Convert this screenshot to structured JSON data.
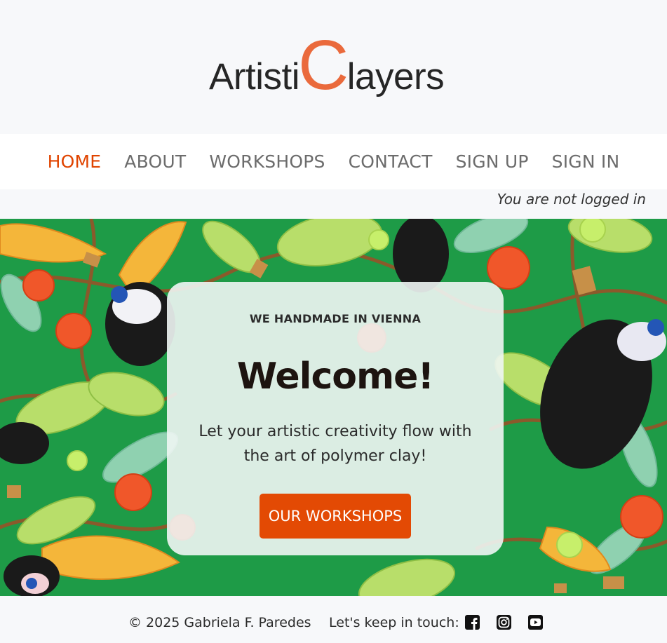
{
  "brand": {
    "logo_start": "Artisti",
    "logo_c": "C",
    "logo_end": "layers",
    "accent": "#ea6a3c"
  },
  "nav": {
    "items": [
      {
        "label": "HOME",
        "active": true
      },
      {
        "label": "ABOUT",
        "active": false
      },
      {
        "label": "WORKSHOPS",
        "active": false
      },
      {
        "label": "CONTACT",
        "active": false
      },
      {
        "label": "SIGN UP",
        "active": false
      },
      {
        "label": "SIGN IN",
        "active": false
      }
    ],
    "active_color": "#e04400"
  },
  "auth": {
    "status": "You are not logged in"
  },
  "hero": {
    "tagline": "WE HANDMADE IN VIENNA",
    "title": "Welcome!",
    "subtitle_line1": "Let your artistic creativity flow with",
    "subtitle_line2": "the art of polymer clay!",
    "cta_label": "OUR WORKSHOPS",
    "cta_color": "#e34a04"
  },
  "footer": {
    "copyright": "© 2025 Gabriela F. Paredes",
    "touch_label": "Let's keep in touch:",
    "social": [
      "facebook-icon",
      "instagram-icon",
      "youtube-icon"
    ]
  }
}
